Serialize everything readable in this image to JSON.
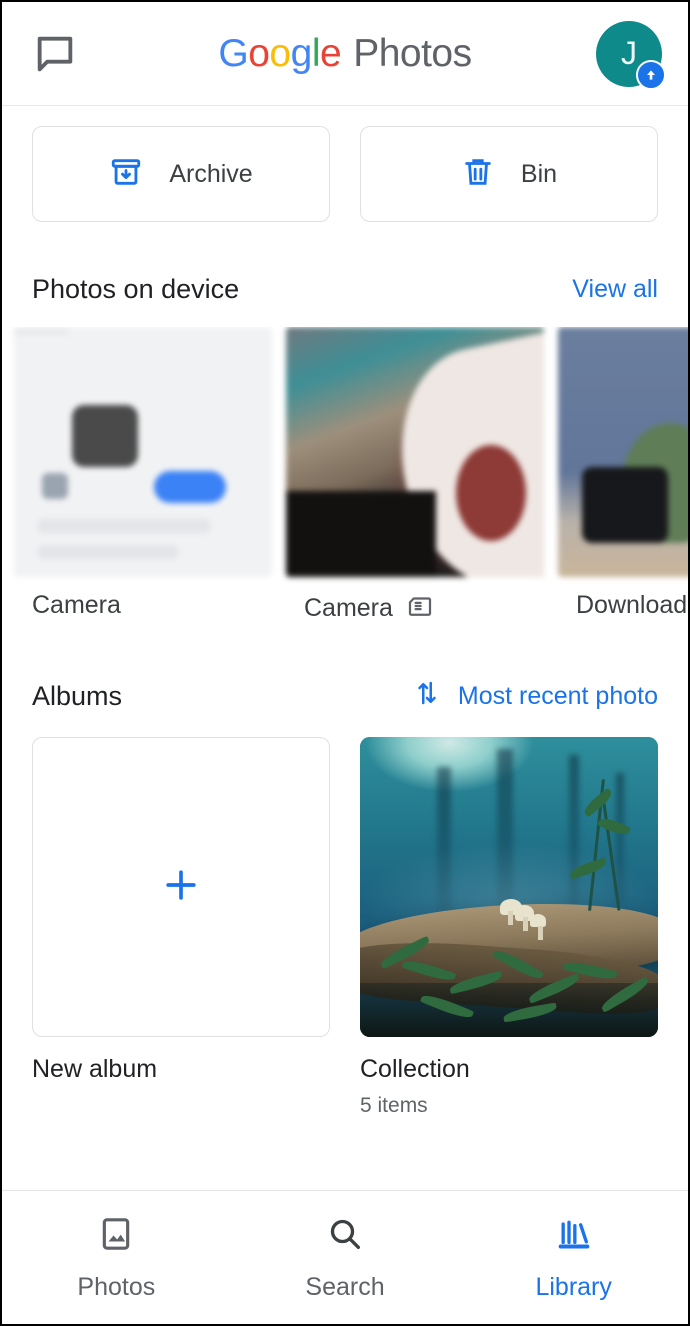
{
  "header": {
    "chat_icon": "chat-bubble-icon",
    "logo_letters": [
      "G",
      "o",
      "o",
      "g",
      "l",
      "e"
    ],
    "logo_suffix": "Photos",
    "avatar_initial": "J",
    "avatar_badge_icon": "upload-arrow-icon",
    "avatar_color": "#0f8a8a",
    "badge_color": "#1a73e8"
  },
  "quick_actions": [
    {
      "label": "Archive",
      "icon": "archive-box-icon"
    },
    {
      "label": "Bin",
      "icon": "trash-bin-icon"
    }
  ],
  "device_section": {
    "title": "Photos on device",
    "action_label": "View all",
    "items": [
      {
        "label": "Camera",
        "badge_icon": ""
      },
      {
        "label": "Camera",
        "badge_icon": "sd-card-icon"
      },
      {
        "label": "Download",
        "badge_icon": ""
      }
    ]
  },
  "albums_section": {
    "title": "Albums",
    "sort_icon": "sort-arrows-icon",
    "sort_label": "Most recent photo",
    "new_album": {
      "label": "New album",
      "icon": "plus-icon"
    },
    "albums": [
      {
        "name": "Collection",
        "subtitle": "5 items"
      }
    ]
  },
  "bottom_nav": {
    "items": [
      {
        "label": "Photos",
        "icon": "image-icon",
        "active": false
      },
      {
        "label": "Search",
        "icon": "search-icon",
        "active": false
      },
      {
        "label": "Library",
        "icon": "library-books-icon",
        "active": true
      }
    ]
  },
  "colors": {
    "accent": "#1a73e8",
    "text": "#3c4043",
    "muted": "#5f6368"
  }
}
